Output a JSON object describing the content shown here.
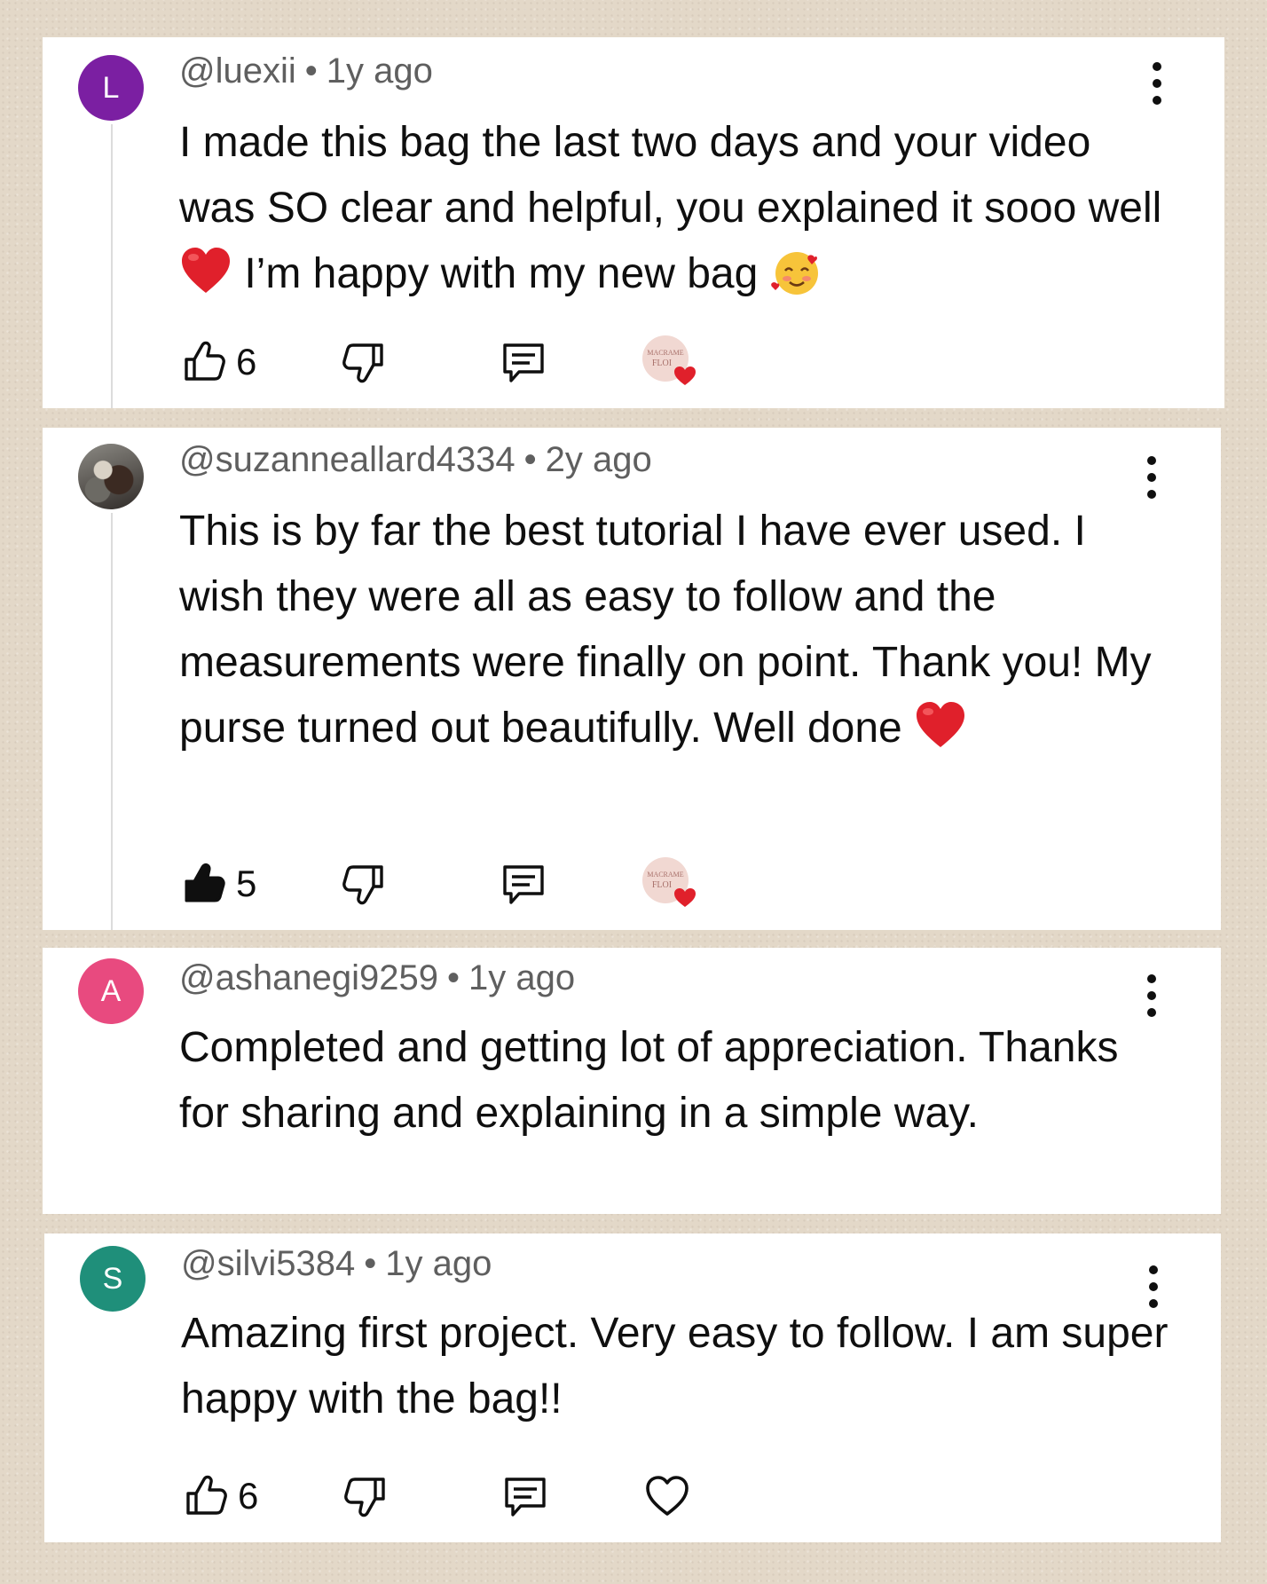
{
  "comments": [
    {
      "avatar_letter": "L",
      "avatar_color": "#7b1fa2",
      "handle": "@luexii",
      "separator": "•",
      "age": "1y ago",
      "text_1": "I made this bag the last two days and your video was SO clear and helpful, you explained it sooo well",
      "text_2": "I’m happy with my new bag",
      "likes": "6",
      "liked": false,
      "creator_heart": true
    },
    {
      "avatar_letter": "",
      "handle": "@suzanneallard4334",
      "separator": "•",
      "age": "2y ago",
      "text_1": "This is by far the best tutorial I have ever used. I wish they were all as easy to follow and the measurements were finally on point. Thank you! My purse turned out beautifully. Well done",
      "likes": "5",
      "liked": true,
      "creator_heart": true
    },
    {
      "avatar_letter": "A",
      "avatar_color": "#e84a7f",
      "handle": "@ashanegi9259",
      "separator": "•",
      "age": "1y ago",
      "text_1": "Completed and getting lot of appreciation. Thanks for sharing and explaining in a simple way."
    },
    {
      "avatar_letter": "S",
      "avatar_color": "#1f8f7a",
      "handle": "@silvi5384",
      "separator": "•",
      "age": "1y ago",
      "text_1": "Amazing first project. Very easy to follow. I am super happy with the bag!!",
      "likes": "6",
      "liked": false,
      "creator_heart": false
    }
  ],
  "icons": {
    "like": "thumb-up-icon",
    "dislike": "thumb-down-icon",
    "reply": "reply-icon",
    "more": "more-vert-icon",
    "heart": "heart-outline-icon"
  }
}
